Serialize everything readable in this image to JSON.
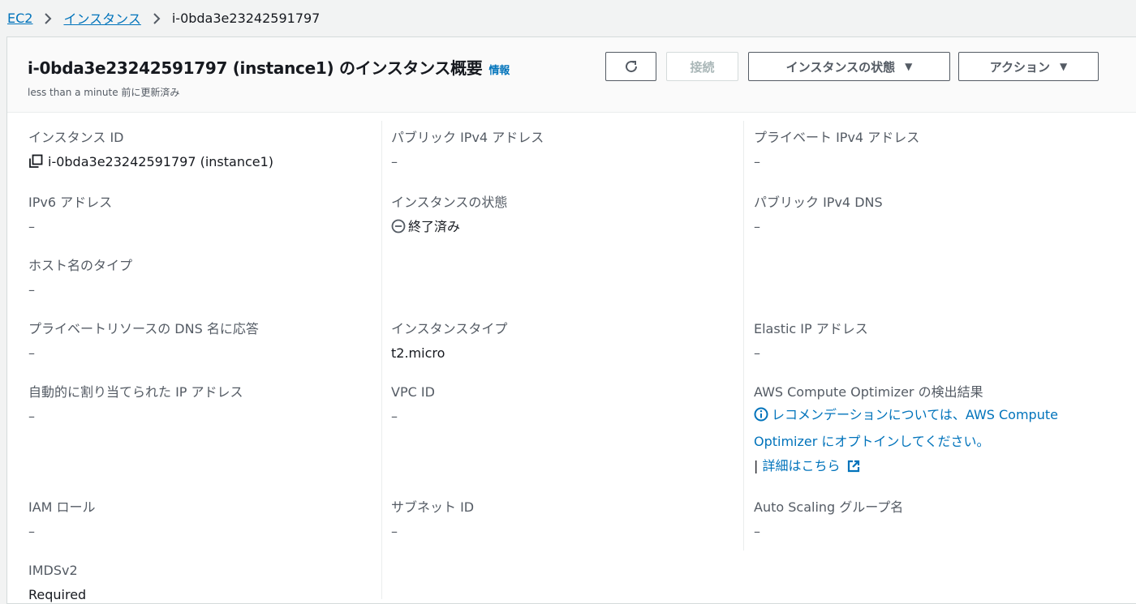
{
  "breadcrumb": {
    "root": "EC2",
    "instances": "インスタンス",
    "current": "i-0bda3e23242591797"
  },
  "header": {
    "title": "i-0bda3e23242591797 (instance1) のインスタンス概要",
    "info": "情報",
    "updated": "less than a minute 前に更新済み",
    "connect_label": "接続",
    "state_label": "インスタンスの状態",
    "action_label": "アクション"
  },
  "fields": {
    "instance_id": {
      "label": "インスタンス ID",
      "value": "i-0bda3e23242591797 (instance1)"
    },
    "public_ipv4": {
      "label": "パブリック IPv4 アドレス",
      "value": "–"
    },
    "private_ipv4": {
      "label": "プライベート IPv4 アドレス",
      "value": "–"
    },
    "ipv6": {
      "label": "IPv6 アドレス",
      "value": "–"
    },
    "instance_state": {
      "label": "インスタンスの状態",
      "value": "終了済み"
    },
    "public_dns": {
      "label": "パブリック IPv4 DNS",
      "value": "–"
    },
    "hostname_type": {
      "label": "ホスト名のタイプ",
      "value": "–"
    },
    "private_dns_answer": {
      "label": "プライベートリソースの DNS 名に応答",
      "value": "–"
    },
    "instance_type": {
      "label": "インスタンスタイプ",
      "value": "t2.micro"
    },
    "elastic_ip": {
      "label": "Elastic IP アドレス",
      "value": "–"
    },
    "auto_ip": {
      "label": "自動的に割り当てられた IP アドレス",
      "value": "–"
    },
    "vpc_id": {
      "label": "VPC ID",
      "value": "–"
    },
    "optimizer": {
      "label": "AWS Compute Optimizer の検出結果",
      "message": "レコメンデーションについては、AWS Compute Optimizer にオプトインしてください。",
      "separator": "|",
      "details": "詳細はこちら"
    },
    "iam_role": {
      "label": "IAM ロール",
      "value": "–"
    },
    "subnet_id": {
      "label": "サブネット ID",
      "value": "–"
    },
    "asg_name": {
      "label": "Auto Scaling グループ名",
      "value": "–"
    },
    "imdsv2": {
      "label": "IMDSv2",
      "value": "Required"
    }
  },
  "colors": {
    "link": "#0073bb",
    "label": "#545b64",
    "text": "#16191f"
  }
}
